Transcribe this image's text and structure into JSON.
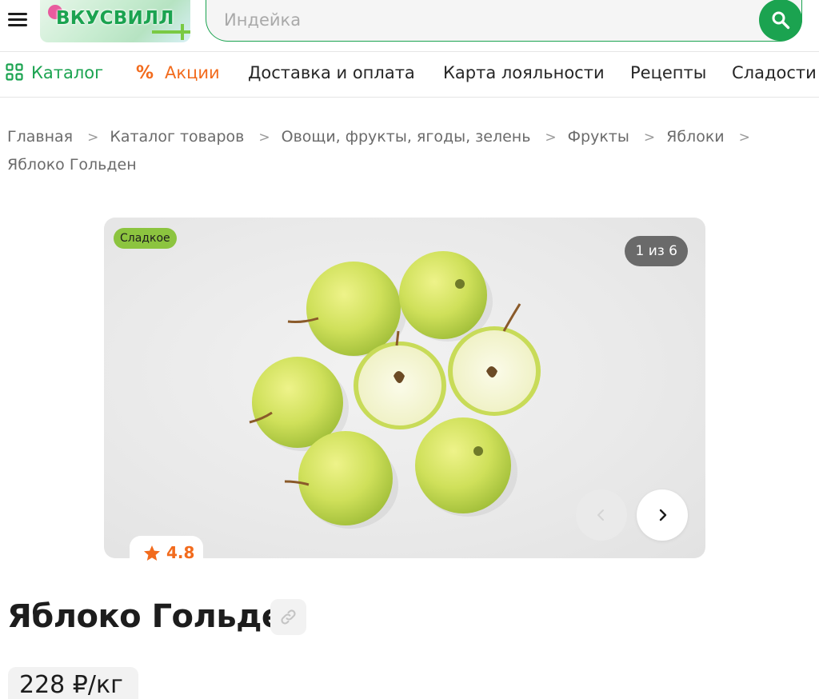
{
  "header": {
    "logo_text": "ВКУСВИЛЛ",
    "search_placeholder": "Индейка"
  },
  "nav": {
    "catalog": "Каталог",
    "promo": "Акции",
    "delivery": "Доставка и оплата",
    "loyalty": "Карта лояльности",
    "recipes": "Рецепты",
    "sweets": "Сладости"
  },
  "breadcrumbs": [
    "Главная",
    "Каталог товаров",
    "Овощи, фрукты, ягоды, зелень",
    "Фрукты",
    "Яблоки",
    "Яблоко Гольден"
  ],
  "gallery": {
    "tag": "Сладкое",
    "counter": "1 из 6"
  },
  "product": {
    "rating": "4.8",
    "title": "Яблоко Гольден",
    "price": "228 ₽/кг"
  },
  "colors": {
    "brand_green": "#1ba350",
    "promo_orange": "#f26b1d",
    "tag_green": "#8cc43f"
  },
  "icons": {
    "menu": "burger-menu-icon",
    "search": "search-icon",
    "catalog": "grid-icon",
    "promo": "percent-icon",
    "prev": "chevron-left-icon",
    "next": "chevron-right-icon",
    "rating": "star-icon",
    "share": "link-icon"
  }
}
